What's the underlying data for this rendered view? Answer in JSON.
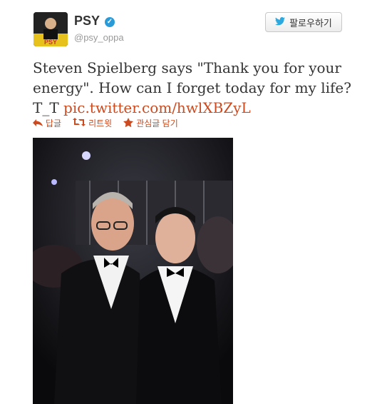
{
  "user": {
    "name": "PSY",
    "handle": "@psy_oppa",
    "avatar_text": "PSY"
  },
  "follow_button": {
    "label": "팔로우하기"
  },
  "tweet": {
    "text": "Steven Spielberg says \"Thank you for your energy\". How can I forget today for my life? T_T",
    "link": "pic.twitter.com/hwlXBZyL"
  },
  "actions": {
    "reply": "답글",
    "retweet": "리트윗",
    "favorite": "관심글 담기"
  },
  "colors": {
    "link": "#cc4a1f",
    "verified": "#2b9bd8",
    "follow_icon": "#2aa9e0"
  }
}
